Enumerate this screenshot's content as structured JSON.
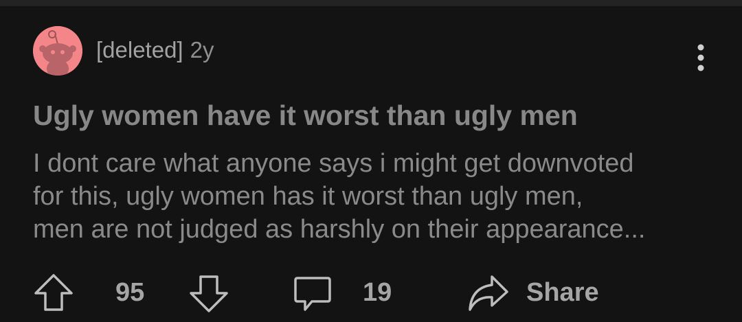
{
  "post": {
    "author": "[deleted]",
    "age": "2y",
    "title": "Ugly women have it worst than ugly men",
    "body_lines": [
      "I dont care what anyone says i might get downvoted",
      "for this, ugly women  has it worst than ugly men,",
      "men are not judged as harshly on their  appearance..."
    ]
  },
  "actions": {
    "upvote_count": "95",
    "comment_count": "19",
    "share_label": "Share"
  },
  "icons": {
    "avatar": "snoo-avatar-icon",
    "more": "more-vertical-icon",
    "upvote": "upvote-arrow-icon",
    "downvote": "downvote-arrow-icon",
    "comment": "comment-bubble-icon",
    "share": "share-arrow-icon"
  },
  "colors": {
    "background": "#131313",
    "avatar_bg": "#f4868a",
    "text_muted": "#8a8a8a"
  }
}
